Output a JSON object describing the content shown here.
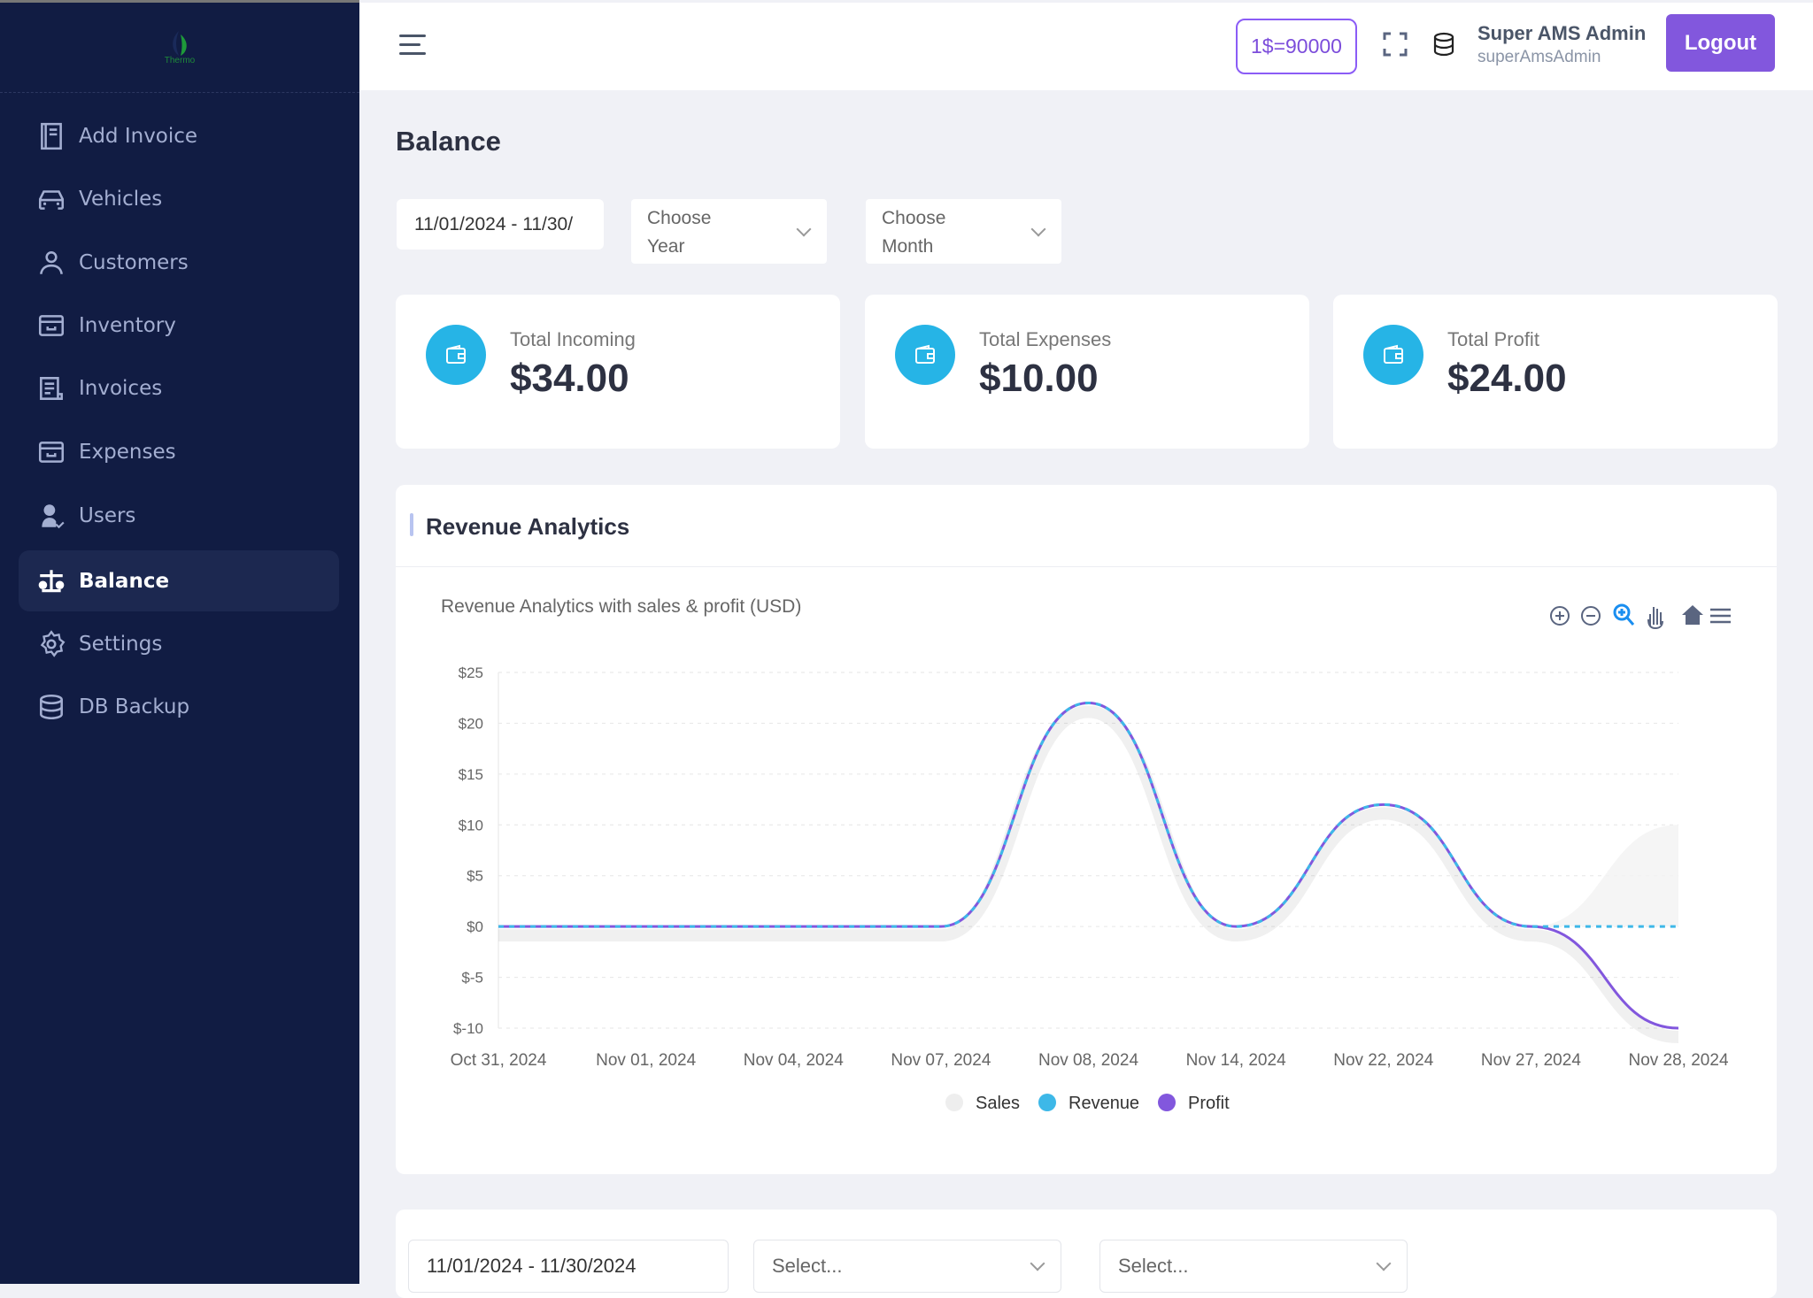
{
  "sidebar": {
    "logo_text": "Thermo",
    "items": [
      {
        "label": "Add Invoice",
        "icon": "notebook-icon"
      },
      {
        "label": "Vehicles",
        "icon": "car-icon"
      },
      {
        "label": "Customers",
        "icon": "user-icon"
      },
      {
        "label": "Inventory",
        "icon": "archive-icon"
      },
      {
        "label": "Invoices",
        "icon": "receipt-icon"
      },
      {
        "label": "Expenses",
        "icon": "archive-icon"
      },
      {
        "label": "Users",
        "icon": "user-check-icon"
      },
      {
        "label": "Balance",
        "icon": "scale-icon",
        "active": true
      },
      {
        "label": "Settings",
        "icon": "gear-icon"
      },
      {
        "label": "DB Backup",
        "icon": "database-icon"
      }
    ]
  },
  "header": {
    "rate": "1$=90000",
    "user_name": "Super AMS Admin",
    "user_login": "superAmsAdmin",
    "logout": "Logout"
  },
  "page": {
    "title": "Balance",
    "date_range": "11/01/2024 - 11/30/",
    "year_placeholder": "Choose Year",
    "month_placeholder": "Choose Month"
  },
  "cards": [
    {
      "label": "Total Incoming",
      "value": "$34.00"
    },
    {
      "label": "Total Expenses",
      "value": "$10.00"
    },
    {
      "label": "Total Profit",
      "value": "$24.00"
    }
  ],
  "accent": "#8257dd",
  "card_icon_color": "#26b4e6",
  "revenue": {
    "title": "Revenue Analytics"
  },
  "chart_data": {
    "type": "line",
    "title": "Revenue Analytics with sales & profit (USD)",
    "categories": [
      "Oct 31, 2024",
      "Nov 01, 2024",
      "Nov 04, 2024",
      "Nov 07, 2024",
      "Nov 08, 2024",
      "Nov 14, 2024",
      "Nov 22, 2024",
      "Nov 27, 2024",
      "Nov 28, 2024"
    ],
    "yticks": [
      "$25",
      "$20",
      "$15",
      "$10",
      "$5",
      "$0",
      "$-5",
      "$-10"
    ],
    "ylim": [
      -10,
      25
    ],
    "grid": true,
    "legend": "bottom",
    "series": [
      {
        "name": "Sales",
        "type": "area",
        "color": "#eeeeee",
        "values": [
          0,
          0,
          0,
          0,
          0,
          0,
          0,
          0,
          10
        ]
      },
      {
        "name": "Revenue",
        "type": "line",
        "color": "#3db8e8",
        "values": [
          0,
          0,
          0,
          0,
          22,
          0,
          12,
          0,
          0
        ]
      },
      {
        "name": "Profit",
        "type": "line",
        "color": "#8257dd",
        "values": [
          0,
          0,
          0,
          0,
          22,
          0,
          12,
          0,
          -10
        ]
      }
    ]
  },
  "bottom": {
    "date_range": "11/01/2024 - 11/30/2024",
    "select1": "Select...",
    "select2": "Select..."
  }
}
